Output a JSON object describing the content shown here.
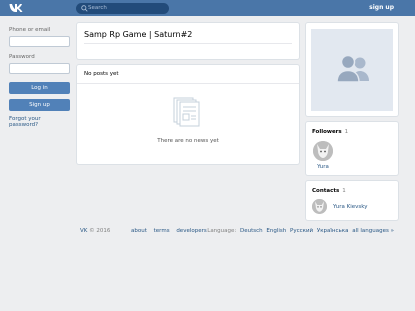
{
  "header": {
    "logo_icon": "vk-logo-icon",
    "search_placeholder": "Search",
    "signup_label": "sign up"
  },
  "login": {
    "phone_label": "Phone or email",
    "password_label": "Password",
    "login_button": "Log in",
    "signup_button": "Sign up",
    "forgot_link": "Forgot your password?"
  },
  "page": {
    "title": "Samp Rp Game | Saturn#2"
  },
  "wall": {
    "header": "No posts yet",
    "empty_text": "There are no news yet"
  },
  "followers": {
    "title": "Followers",
    "count": "1",
    "items": [
      {
        "name": "Yura"
      }
    ]
  },
  "contacts": {
    "title": "Contacts",
    "count": "1",
    "items": [
      {
        "name": "Yura Kievsky"
      }
    ]
  },
  "footer": {
    "brand": "VK",
    "copyright": "© 2016",
    "links": [
      "about",
      "terms",
      "developers"
    ],
    "language_label": "Language:",
    "languages": [
      "Deutsch",
      "English",
      "Русский",
      "Українська",
      "all languages »"
    ]
  },
  "colors": {
    "header_bg": "#4a76a8",
    "page_bg": "#edeef0",
    "link": "#2a5885",
    "button": "#5181b8"
  }
}
